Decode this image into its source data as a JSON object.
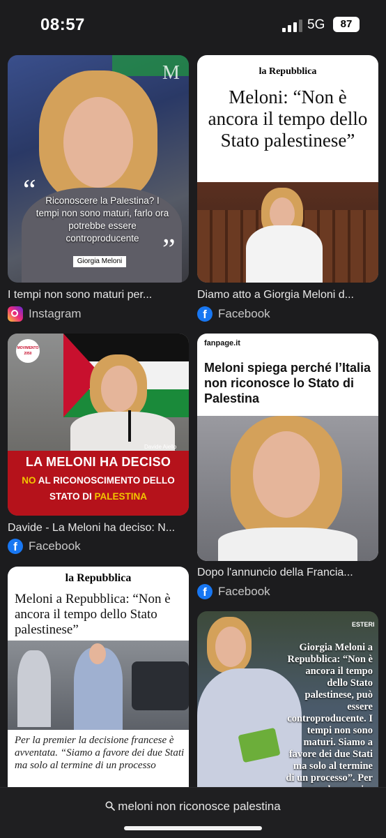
{
  "status_bar": {
    "time": "08:57",
    "network": "5G",
    "battery": "87"
  },
  "results": [
    {
      "caption": "I tempi non sono maturi per...",
      "source": "Instagram",
      "source_icon": "instagram-icon",
      "image_text": {
        "quote": "Riconoscere la Palestina? I tempi non sono maturi, farlo ora potrebbe essere controproducente",
        "name": "Giorgia Meloni",
        "logo": "M"
      }
    },
    {
      "caption": "Diamo atto a Giorgia Meloni d...",
      "source": "Facebook",
      "source_icon": "facebook-icon",
      "image_text": {
        "masthead": "la Repubblica",
        "headline": "Meloni: “Non è ancora il tempo dello Stato palestinese”"
      }
    },
    {
      "caption": "Davide - La Meloni ha deciso: N...",
      "source": "Facebook",
      "source_icon": "facebook-icon",
      "image_text": {
        "badge": "MOVIMENTO 2050",
        "credit": "Davide Aiello",
        "line1": "LA MELONI HA DECISO",
        "line2a": "NO",
        "line2b": " AL RICONOSCIMENTO DELLO",
        "line3a": "STATO DI ",
        "line3b": "PALESTINA"
      }
    },
    {
      "caption": "Dopo l'annuncio della Francia...",
      "source": "Facebook",
      "source_icon": "facebook-icon",
      "image_text": {
        "masthead": "fanpage.it",
        "headline": "Meloni spiega perché l’Italia non riconosce lo Stato di Palestina"
      }
    },
    {
      "caption": "",
      "source": "",
      "image_text": {
        "masthead": "la Repubblica",
        "headline": "Meloni a Repubblica: “Non è ancora il tempo dello Stato palestinese”",
        "body": "Per la premier la decisione francese è avventata. “Siamo a favore dei due Stati ma solo al termine di un processo"
      }
    },
    {
      "caption": "",
      "source": "",
      "image_text": {
        "section": "ESTERI",
        "headline": "Giorgia Meloni a Repubblica: “Non è ancora il tempo dello Stato palestinese, può essere controproducente. I tempi non sono maturi. Siamo a favore dei due Stati ma solo al termine di un processo”. Per la premier"
      }
    }
  ],
  "search": {
    "query": "meloni non riconosce palestina"
  },
  "colors": {
    "background": "#1c1c1e",
    "red_banner": "#b5121b",
    "yellow": "#f2c500"
  }
}
